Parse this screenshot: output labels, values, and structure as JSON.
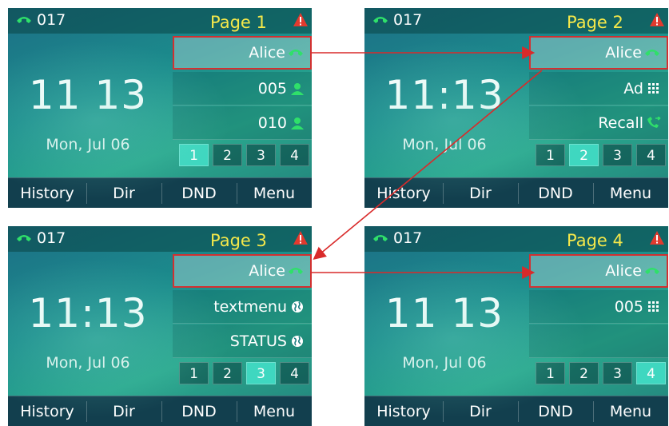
{
  "colors": {
    "highlight_border": "#d23030",
    "page_label": "#f5e84a",
    "active_page": "#3fd7c0",
    "arrow": "#d92a2a"
  },
  "screens": [
    {
      "line": "017",
      "page_label": "Page 1",
      "clock": "11 13",
      "date": "Mon, Jul 06",
      "keys": [
        {
          "label": "Alice",
          "icon": "green-handset-icon"
        },
        {
          "label": "005",
          "icon": "green-person-icon"
        },
        {
          "label": "010",
          "icon": "green-person-icon"
        }
      ],
      "pages": [
        "1",
        "2",
        "3",
        "4"
      ],
      "active_page": 1,
      "softkeys": [
        "History",
        "Dir",
        "DND",
        "Menu"
      ]
    },
    {
      "line": "017",
      "page_label": "Page 2",
      "clock": "11:13",
      "date": "Mon, Jul 06",
      "keys": [
        {
          "label": "Alice",
          "icon": "green-handset-icon"
        },
        {
          "label": "Ad",
          "icon": "keypad-icon"
        },
        {
          "label": "Recall",
          "icon": "recall-icon"
        }
      ],
      "pages": [
        "1",
        "2",
        "3",
        "4"
      ],
      "active_page": 2,
      "softkeys": [
        "History",
        "Dir",
        "DND",
        "Menu"
      ]
    },
    {
      "line": "017",
      "page_label": "Page 3",
      "clock": "11:13",
      "date": "Mon, Jul 06",
      "keys": [
        {
          "label": "Alice",
          "icon": "green-handset-icon"
        },
        {
          "label": "textmenu",
          "icon": "globe-icon"
        },
        {
          "label": "STATUS",
          "icon": "globe-icon"
        }
      ],
      "pages": [
        "1",
        "2",
        "3",
        "4"
      ],
      "active_page": 3,
      "softkeys": [
        "History",
        "Dir",
        "DND",
        "Menu"
      ]
    },
    {
      "line": "017",
      "page_label": "Page 4",
      "clock": "11 13",
      "date": "Mon, Jul 06",
      "keys": [
        {
          "label": "Alice",
          "icon": "green-handset-icon"
        },
        {
          "label": "005",
          "icon": "keypad-icon"
        },
        {
          "label": "",
          "icon": ""
        }
      ],
      "pages": [
        "1",
        "2",
        "3",
        "4"
      ],
      "active_page": 4,
      "softkeys": [
        "History",
        "Dir",
        "DND",
        "Menu"
      ]
    }
  ]
}
